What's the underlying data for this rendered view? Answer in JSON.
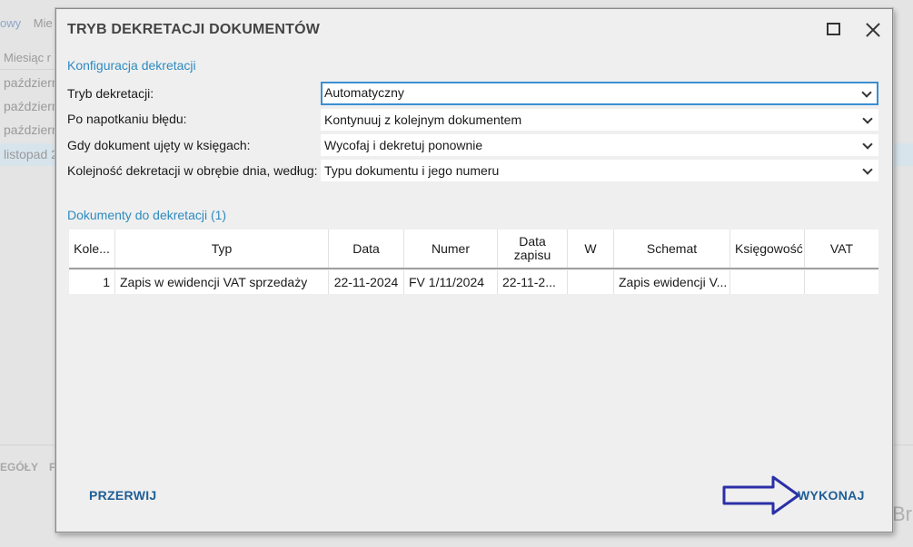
{
  "background": {
    "tabs": [
      "owy",
      "Mie"
    ],
    "column_header": "Miesiąc r",
    "rows": [
      "październ",
      "październ",
      "październ",
      "listopad 2"
    ],
    "bottom_tab": "EGÓŁY",
    "bottom_tab2": "F",
    "corner_text": "Br"
  },
  "dialog": {
    "title": "TRYB DEKRETACJI DOKUMENTÓW",
    "config_section": "Konfiguracja dekretacji",
    "fields": [
      {
        "label": "Tryb dekretacji:",
        "value": "Automatyczny"
      },
      {
        "label": "Po napotkaniu błędu:",
        "value": "Kontynuuj z kolejnym dokumentem"
      },
      {
        "label": "Gdy dokument ujęty w księgach:",
        "value": "Wycofaj i dekretuj ponownie"
      },
      {
        "label": "Kolejność dekretacji w obrębie dnia, według:",
        "value": "Typu dokumentu i jego numeru"
      }
    ],
    "docs_section": "Dokumenty do dekretacji (1)",
    "table": {
      "headers": [
        "Kole...",
        "Typ",
        "Data",
        "Numer",
        "Data zapisu",
        "W",
        "Schemat",
        "Księgowość",
        "VAT"
      ],
      "rows": [
        [
          "1",
          "Zapis w ewidencji VAT sprzedaży",
          "22-11-2024",
          "FV 1/11/2024",
          "22-11-2...",
          "",
          "Zapis ewidencji V...",
          "",
          ""
        ]
      ]
    },
    "cancel_label": "PRZERWIJ",
    "execute_label": "WYKONAJ",
    "colors": {
      "accent": "#2e8bc0",
      "button_text": "#1f5e96",
      "arrow": "#2b2fa8"
    },
    "icons": [
      "maximize-icon",
      "close-icon",
      "chevron-down-icon",
      "arrow-right-icon"
    ]
  }
}
